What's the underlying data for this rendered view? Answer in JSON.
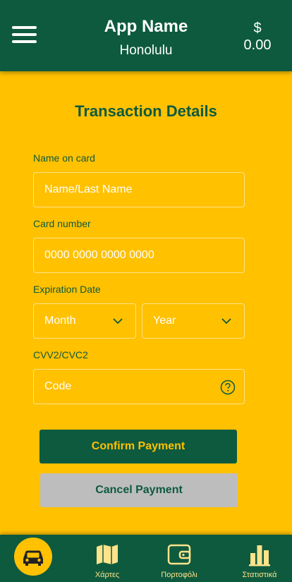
{
  "header": {
    "title": "App Name",
    "subtitle": "Honolulu",
    "currency": "$",
    "balance": "0.00"
  },
  "form": {
    "title": "Transaction Details",
    "name_label": "Name on card",
    "name_placeholder": "Name/Last Name",
    "card_label": "Card number",
    "card_placeholder": "0000 0000 0000 0000",
    "expiry_label": "Expiration Date",
    "month_value": "Month",
    "year_value": "Year",
    "cvv_label": "CVV2/CVC2",
    "cvv_placeholder": "Code"
  },
  "actions": {
    "confirm_label": "Confirm Payment",
    "cancel_label": "Cancel Payment"
  },
  "bottom_nav": {
    "items": [
      {
        "icon": "car-icon",
        "label": ""
      },
      {
        "icon": "map-icon",
        "label": "Χάρτες"
      },
      {
        "icon": "wallet-icon",
        "label": "Πορτοφόλι"
      },
      {
        "icon": "bar-chart-icon",
        "label": "Στατιστικά"
      }
    ]
  },
  "colors": {
    "primary": "#0E5A3F",
    "accent": "#FFC100",
    "cancel": "#BDBDBD"
  }
}
